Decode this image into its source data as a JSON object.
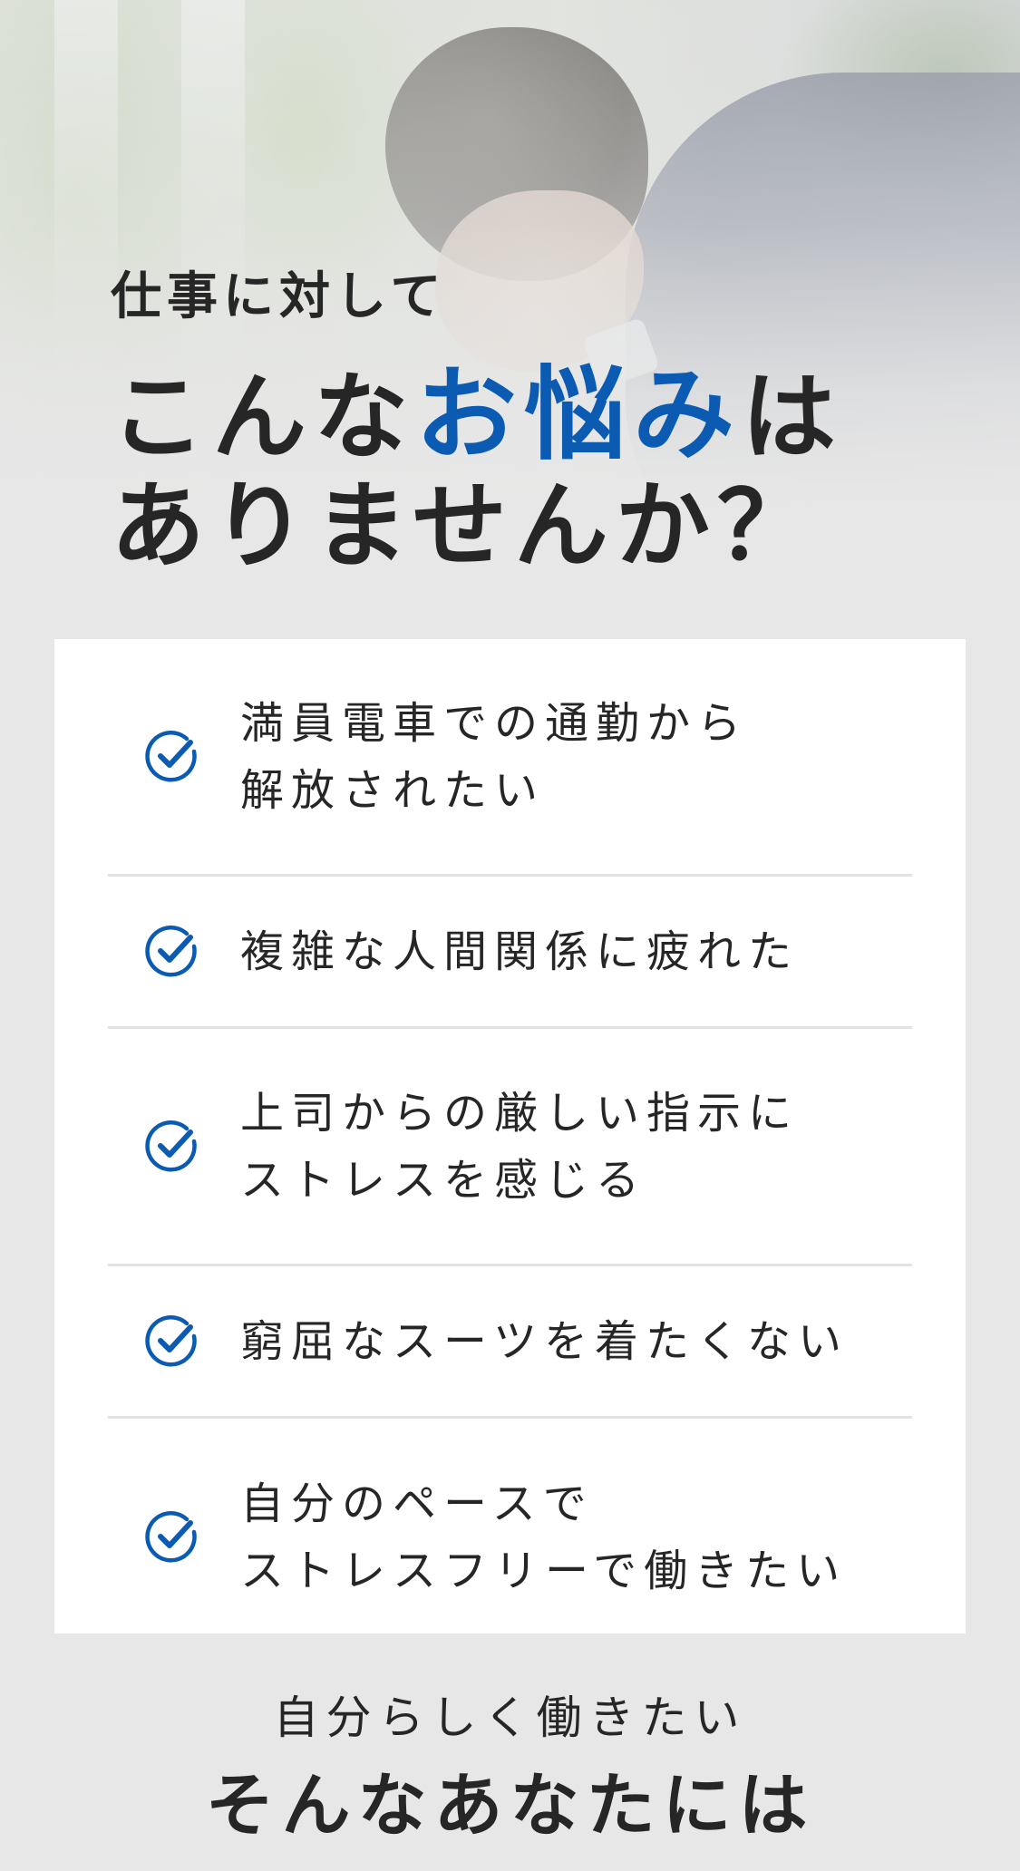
{
  "hero": {
    "subtitle": "仕事に対して",
    "title_line1_before": "こんな",
    "title_line1_accent": "お悩み",
    "title_line1_after": "は",
    "title_line2": "ありませんか？"
  },
  "checklist": {
    "items": [
      {
        "icon": "check-circle-icon",
        "lines": [
          "満員電車での通勤から",
          "解放されたい"
        ]
      },
      {
        "icon": "check-circle-icon",
        "lines": [
          "複雑な人間関係に疲れた"
        ]
      },
      {
        "icon": "check-circle-icon",
        "lines": [
          "上司からの厳しい指示に",
          "ストレスを感じる"
        ]
      },
      {
        "icon": "check-circle-icon",
        "lines": [
          "窮屈なスーツを着たくない"
        ]
      },
      {
        "icon": "check-circle-icon",
        "lines": [
          "自分のペースで",
          "ストレスフリーで働きたい"
        ]
      }
    ]
  },
  "footer": {
    "subtitle": "自分らしく働きたい",
    "title": "そんなあなたには"
  },
  "colors": {
    "accent": "#0b5bb3",
    "text": "#262626",
    "background": "#e7e7e7",
    "card": "#ffffff",
    "divider": "#e2e2e2"
  }
}
